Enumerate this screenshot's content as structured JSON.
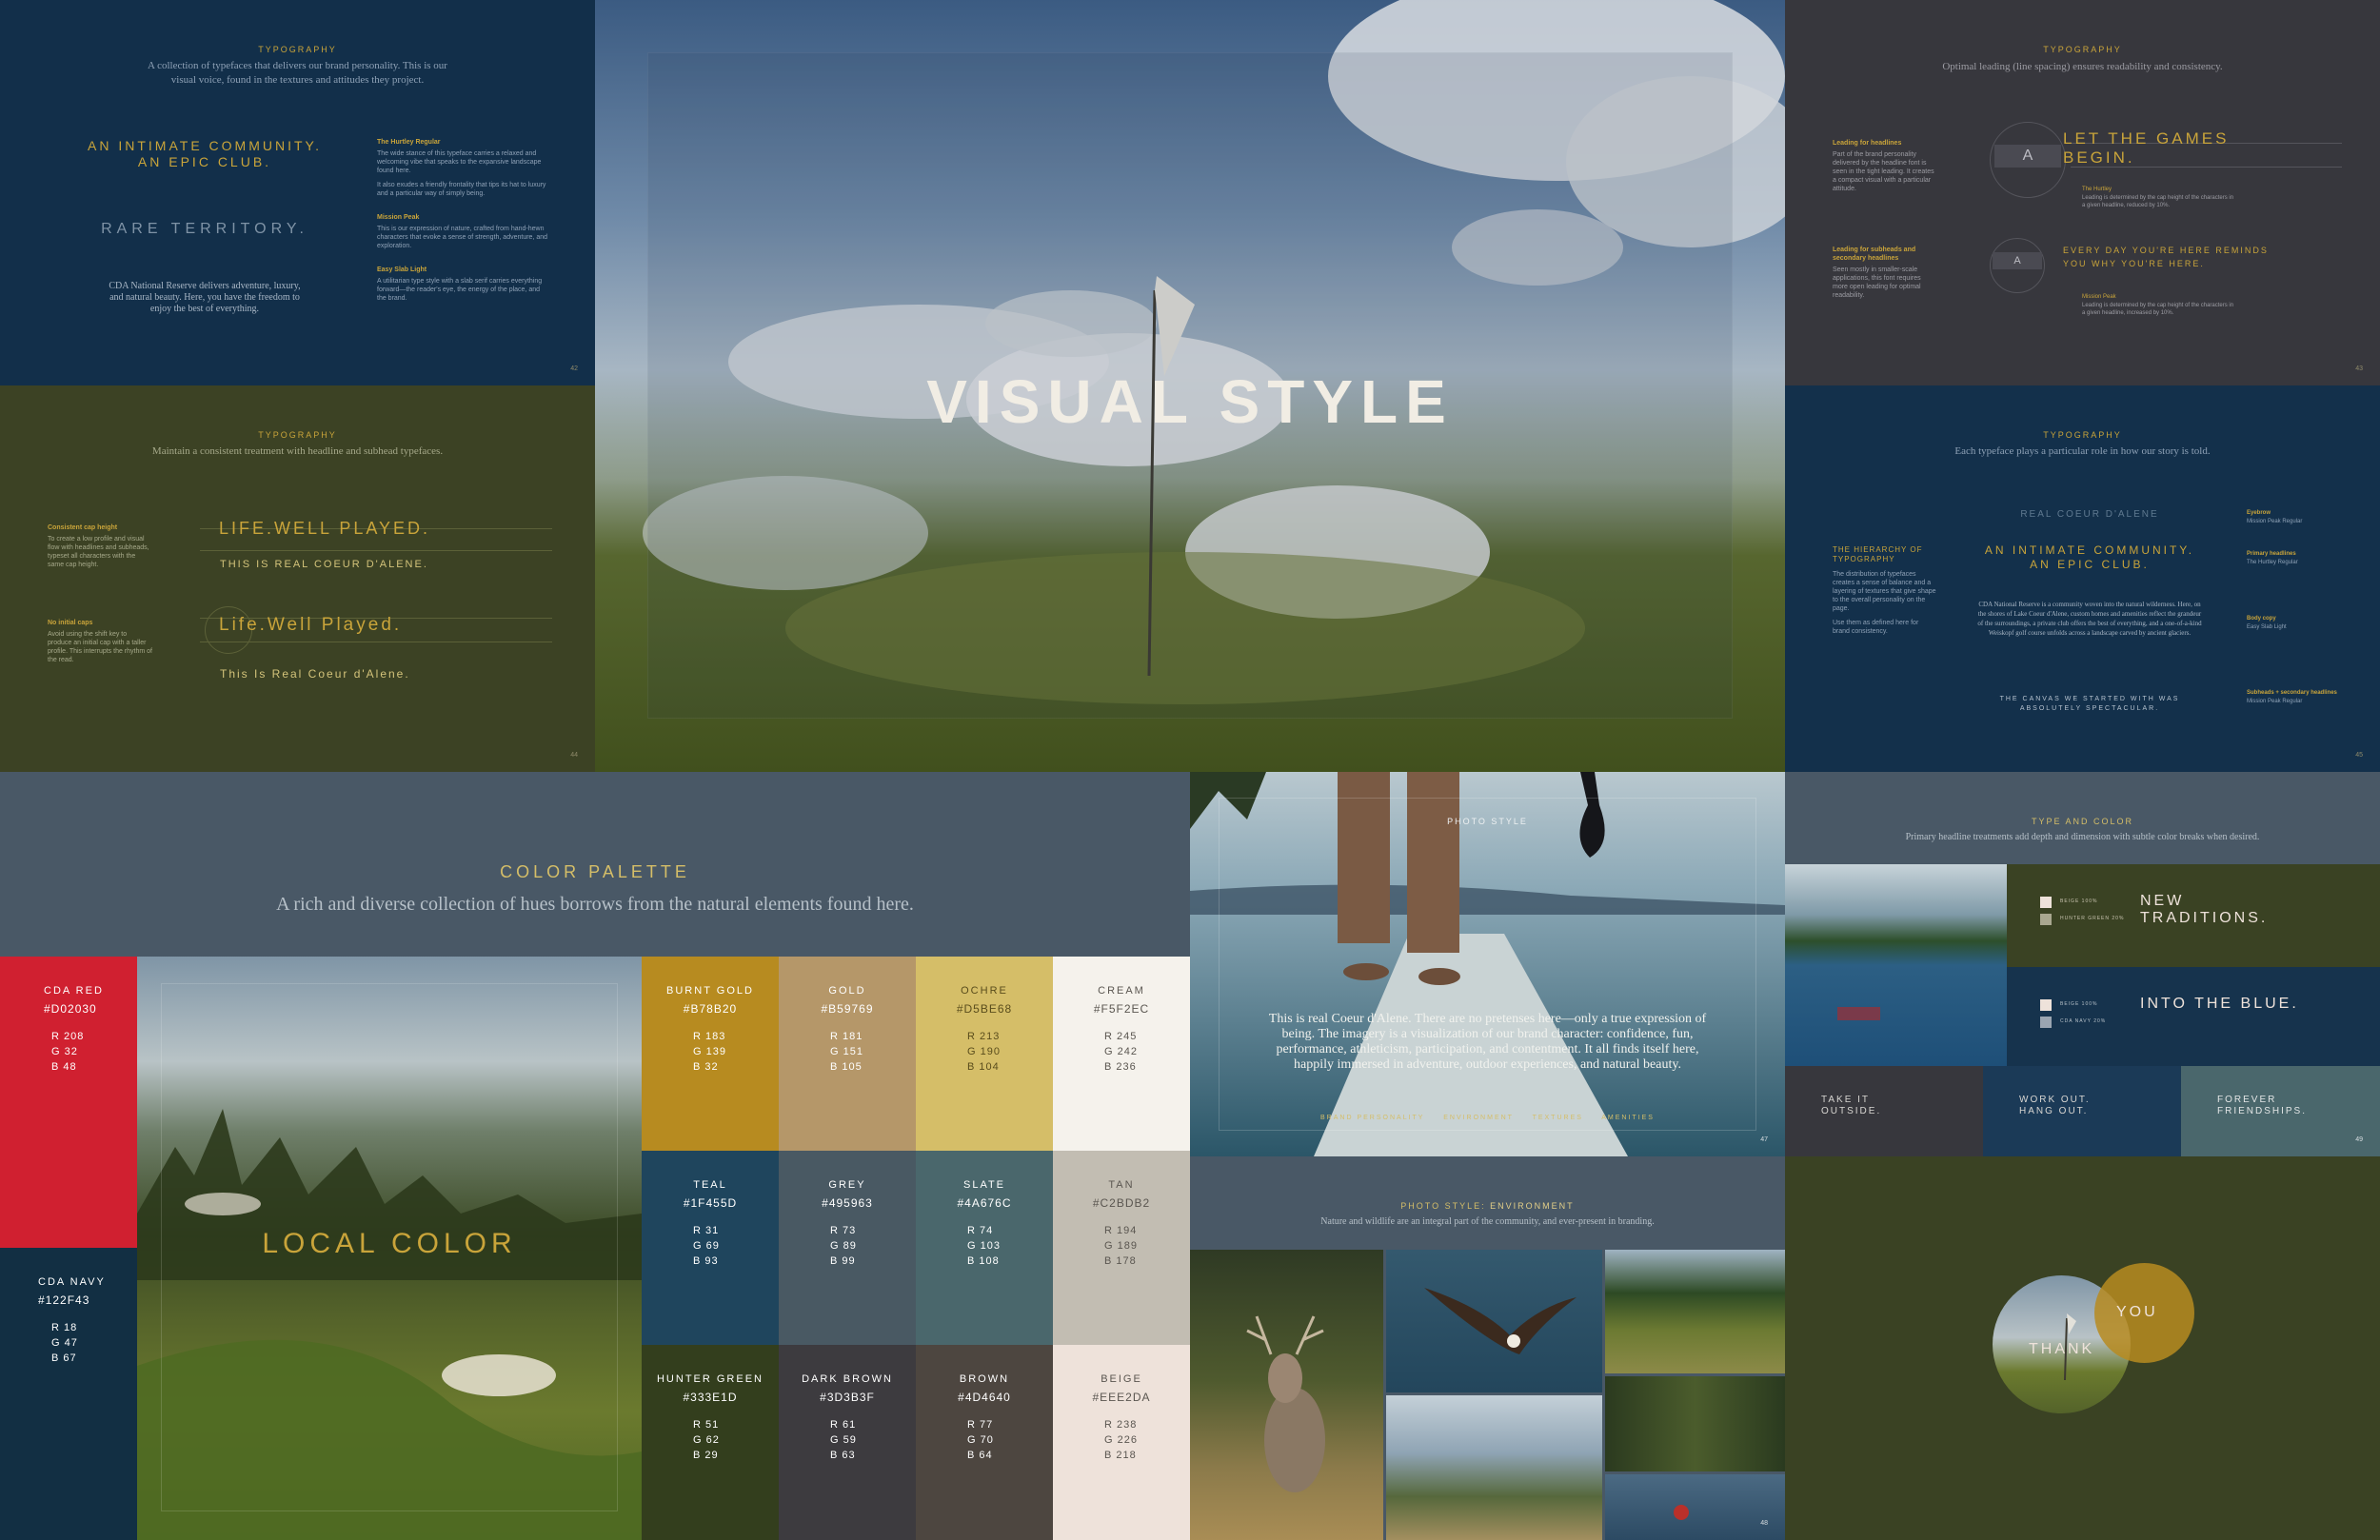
{
  "typo1": {
    "label": "TYPOGRAPHY",
    "intro": "A collection of typefaces that delivers our brand personality. This is our visual voice, found in the textures and attitudes they project.",
    "h1": "AN INTIMATE COMMUNITY. AN EPIC CLUB.",
    "h2": "RARE TERRITORY.",
    "body": "CDA National Reserve delivers adventure, luxury, and natural beauty. Here, you have the freedom to enjoy the best of everything.",
    "n1_title": "The Hurtley Regular",
    "n1_text": "The wide stance of this typeface carries a relaxed and welcoming vibe that speaks to the expansive landscape found here.",
    "n1_text2": "It also exudes a friendly frontality that tips its hat to luxury and a particular way of simply being.",
    "n2_title": "Mission Peak",
    "n2_text": "This is our expression of nature, crafted from hand-hewn characters that evoke a sense of strength, adventure, and exploration.",
    "n3_title": "Easy Slab Light",
    "n3_text": "A utilitarian type style with a slab serif carries everything forward—the reader's eye, the energy of the place, and the brand.",
    "page": "42"
  },
  "typo2": {
    "label": "TYPOGRAPHY",
    "intro": "Maintain a consistent treatment with headline and subhead typefaces.",
    "n1_title": "Consistent cap height",
    "n1_text": "To create a low profile and visual flow with headlines and subheads, typeset all characters with the same cap height.",
    "n2_title": "No initial caps",
    "n2_text": "Avoid using the shift key to produce an initial cap with a taller profile. This interrupts the rhythm of the read.",
    "a1": "LIFE.WELL PLAYED.",
    "a2": "THIS IS REAL COEUR D'ALENE.",
    "b1": "Life.Well Played.",
    "b2": "This Is Real Coeur d'Alene.",
    "page": "44"
  },
  "hero": {
    "title": "VISUAL STYLE"
  },
  "typo3": {
    "label": "TYPOGRAPHY",
    "intro": "Optimal leading (line spacing) ensures readability and consistency.",
    "n1_title": "Leading for headlines",
    "n1_text": "Part of the brand personality delivered by the headline font is seen in the tight leading. It creates a compact visual with a particular attitude.",
    "n2_title": "Leading for subheads and secondary headlines",
    "n2_text": "Seen mostly in smaller-scale applications, this font requires more open leading for optimal readability.",
    "h1": "LET THE GAMES BEGIN.",
    "h1_note_title": "The Hurtley",
    "h1_note": "Leading is determined by the cap height of the characters in a given headline, reduced by 10%.",
    "h2": "EVERY DAY YOU'RE HERE REMINDS YOU WHY YOU'RE HERE.",
    "h2_note_title": "Mission Peak",
    "h2_note": "Leading is determined by the cap height of the characters in a given headline, increased by 10%.",
    "page": "43"
  },
  "typo4": {
    "label": "TYPOGRAPHY",
    "intro": "Each typeface plays a particular role in how our story is told.",
    "side_title": "THE HIERARCHY OF TYPOGRAPHY",
    "side_text": "The distribution of typefaces creates a sense of balance and a layering of textures that give shape to the overall personality on the page.",
    "side_text2": "Use them as defined here for brand consistency.",
    "eyebrow": "REAL COEUR D'ALENE",
    "h1": "AN INTIMATE COMMUNITY. AN EPIC CLUB.",
    "body": "CDA National Reserve is a community woven into the natural wilderness. Here, on the shores of Lake Coeur d'Alene, custom homes and amenities reflect the grandeur of the surroundings, a private club offers the best of everything, and a one-of-a-kind Weiskopf golf course unfolds across a landscape carved by ancient glaciers.",
    "sub": "THE CANVAS WE STARTED WITH WAS ABSOLUTELY SPECTACULAR.",
    "r1_t": "Eyebrow",
    "r1_v": "Mission Peak Regular",
    "r2_t": "Primary headlines",
    "r2_v": "The Hurtley Regular",
    "r3_t": "Body copy",
    "r3_v": "Easy Slab Light",
    "r4_t": "Subheads + secondary headlines",
    "r4_v": "Mission Peak Regular",
    "page": "45"
  },
  "palette": {
    "title": "COLOR PALETTE",
    "intro": "A rich and diverse collection of hues borrows from the natural elements found here.",
    "photo_label": "LOCAL COLOR",
    "side": [
      {
        "name": "CDA RED",
        "hex": "#D02030",
        "r": "R 208",
        "g": "G 32",
        "b": "B 48",
        "bg": "#d02030",
        "fg": "#ffffff"
      },
      {
        "name": "CDA NAVY",
        "hex": "#122F43",
        "r": "R 18",
        "g": "G 47",
        "b": "B 67",
        "bg": "#122f43",
        "fg": "#ffffff"
      }
    ],
    "grid": [
      {
        "name": "BURNT GOLD",
        "hex": "#B78B20",
        "r": "R 183",
        "g": "G 139",
        "b": "B 32",
        "bg": "#b78b20",
        "fg": "#ffffff"
      },
      {
        "name": "GOLD",
        "hex": "#B59769",
        "r": "R 181",
        "g": "G 151",
        "b": "B 105",
        "bg": "#b59769",
        "fg": "#ffffff"
      },
      {
        "name": "OCHRE",
        "hex": "#D5BE68",
        "r": "R 213",
        "g": "G 190",
        "b": "B 104",
        "bg": "#d5be68",
        "fg": "#5a4d1c"
      },
      {
        "name": "CREAM",
        "hex": "#F5F2EC",
        "r": "R 245",
        "g": "G 242",
        "b": "B 236",
        "bg": "#f5f2ec",
        "fg": "#5a5650"
      },
      {
        "name": "TEAL",
        "hex": "#1F455D",
        "r": "R 31",
        "g": "G 69",
        "b": "B 93",
        "bg": "#1f455d",
        "fg": "#ffffff"
      },
      {
        "name": "GREY",
        "hex": "#495963",
        "r": "R 73",
        "g": "G 89",
        "b": "B 99",
        "bg": "#495963",
        "fg": "#ffffff"
      },
      {
        "name": "SLATE",
        "hex": "#4A676C",
        "r": "R 74",
        "g": "G 103",
        "b": "B 108",
        "bg": "#4a676c",
        "fg": "#ffffff"
      },
      {
        "name": "TAN",
        "hex": "#C2BDB2",
        "r": "R 194",
        "g": "G 189",
        "b": "B 178",
        "bg": "#c2bdb2",
        "fg": "#5a5650"
      },
      {
        "name": "HUNTER GREEN",
        "hex": "#333E1D",
        "r": "R 51",
        "g": "G 62",
        "b": "B 29",
        "bg": "#333e1d",
        "fg": "#ffffff"
      },
      {
        "name": "DARK BROWN",
        "hex": "#3D3B3F",
        "r": "R 61",
        "g": "G 59",
        "b": "B 63",
        "bg": "#3d3b3f",
        "fg": "#ffffff"
      },
      {
        "name": "BROWN",
        "hex": "#4D4640",
        "r": "R 77",
        "g": "G 70",
        "b": "B 64",
        "bg": "#4d4640",
        "fg": "#ffffff"
      },
      {
        "name": "BEIGE",
        "hex": "#EEE2DA",
        "r": "R 238",
        "g": "G 226",
        "b": "B 218",
        "bg": "#eee2da",
        "fg": "#5a5650"
      }
    ]
  },
  "photo": {
    "label": "PHOTO STYLE",
    "text": "This is real Coeur d'Alene. There are no pretenses here—only a true expression of being. The imagery is a visualization of our brand character: confidence, fun, performance, athleticism, participation, and contentment. It all finds itself here, happily immersed in adventure, outdoor experiences, and natural beauty.",
    "tags": [
      "BRAND PERSONALITY",
      "ENVIRONMENT",
      "TEXTURES",
      "AMENITIES"
    ],
    "page": "47"
  },
  "env": {
    "label_a": "PHOTO STYLE:",
    "label_b": "ENVIRONMENT",
    "intro": "Nature and wildlife are an integral part of the community, and ever-present in branding.",
    "page": "48"
  },
  "typecolor": {
    "label": "TYPE AND COLOR",
    "intro": "Primary headline treatments add depth and dimension with subtle color breaks when desired.",
    "b1": "NEW TRADITIONS.",
    "b1_k1": "BEIGE 100%",
    "b1_k2": "HUNTER GREEN 20%",
    "b2": "INTO THE BLUE.",
    "b2_k1": "BEIGE 100%",
    "b2_k2": "CDA NAVY 20%",
    "t1": "TAKE IT OUTSIDE.",
    "t2": "WORK OUT. HANG OUT.",
    "t3": "FOREVER FRIENDSHIPS.",
    "page": "49"
  },
  "thanks": {
    "a": "THANK",
    "b": "YOU"
  }
}
